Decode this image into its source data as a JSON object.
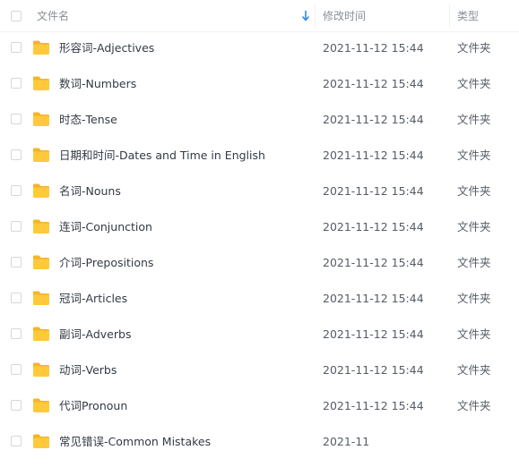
{
  "header": {
    "name_label": "文件名",
    "time_label": "修改时间",
    "type_label": "类型"
  },
  "colors": {
    "folder": "#ffc93c",
    "folder_tab": "#f5b428",
    "sort_arrow": "#2d8cf0"
  },
  "files": [
    {
      "name": "形容词-Adjectives",
      "modified": "2021-11-12 15:44",
      "type": "文件夹"
    },
    {
      "name": "数词-Numbers",
      "modified": "2021-11-12 15:44",
      "type": "文件夹"
    },
    {
      "name": "时态-Tense",
      "modified": "2021-11-12 15:44",
      "type": "文件夹"
    },
    {
      "name": "日期和时间-Dates and Time in English",
      "modified": "2021-11-12 15:44",
      "type": "文件夹"
    },
    {
      "name": "名词-Nouns",
      "modified": "2021-11-12 15:44",
      "type": "文件夹"
    },
    {
      "name": "连词-Conjunction",
      "modified": "2021-11-12 15:44",
      "type": "文件夹"
    },
    {
      "name": "介词-Prepositions",
      "modified": "2021-11-12 15:44",
      "type": "文件夹"
    },
    {
      "name": "冠词-Articles",
      "modified": "2021-11-12 15:44",
      "type": "文件夹"
    },
    {
      "name": "副词-Adverbs",
      "modified": "2021-11-12 15:44",
      "type": "文件夹"
    },
    {
      "name": "动词-Verbs",
      "modified": "2021-11-12 15:44",
      "type": "文件夹"
    },
    {
      "name": "代词Pronoun",
      "modified": "2021-11-12 15:44",
      "type": "文件夹"
    },
    {
      "name": "常见错误-Common Mistakes",
      "modified": "2021-11",
      "type": ""
    }
  ]
}
